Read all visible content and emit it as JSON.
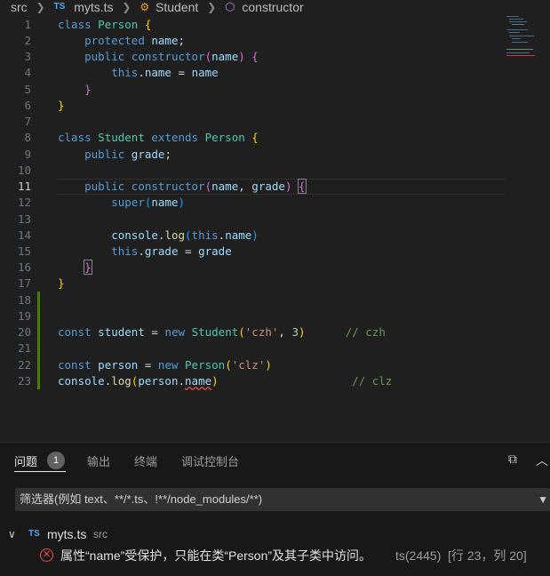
{
  "breadcrumb": {
    "folder": "src",
    "file_badge": "TS",
    "file": "myts.ts",
    "class_name": "Student",
    "method": "constructor"
  },
  "editor": {
    "line_numbers": [
      "1",
      "2",
      "3",
      "4",
      "5",
      "6",
      "7",
      "8",
      "9",
      "10",
      "11",
      "12",
      "13",
      "14",
      "15",
      "16",
      "17",
      "18",
      "19",
      "20",
      "21",
      "22",
      "23"
    ],
    "active_line": "11"
  },
  "panel": {
    "tabs": {
      "problems": "问题",
      "problems_count": "1",
      "output": "输出",
      "terminal": "终端",
      "debug_console": "调试控制台"
    },
    "filter_placeholder": "筛选器(例如 text、**/*.ts、!**/node_modules/**)",
    "file_group": {
      "badge": "TS",
      "file": "myts.ts",
      "folder": "src"
    },
    "error": {
      "message": "属性“name”受保护，只能在类“Person”及其子类中访问。",
      "code": "ts(2445)",
      "location": "[行 23，列 20]"
    }
  },
  "colors": {
    "editor_bg": "#1f1f1f",
    "panel_bg": "#181818",
    "error": "#f14c4c",
    "keyword": "#569cd6",
    "type": "#4ec9b0",
    "comment": "#6a9955"
  }
}
